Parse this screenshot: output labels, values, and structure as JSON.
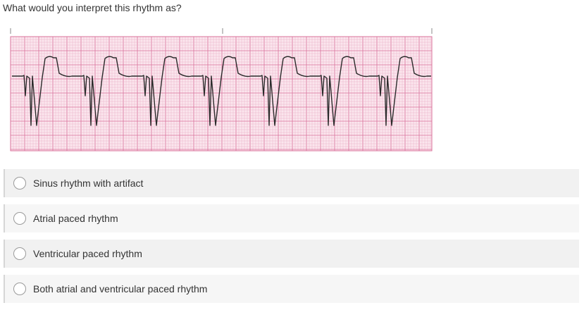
{
  "question": {
    "text": "What would you interpret this rhythm as?"
  },
  "strip": {
    "grid_color": "#e9a9c0",
    "grid_major_color": "#d9709a",
    "paper_color": "#fbe6ee",
    "trace_color": "#2b2b2b"
  },
  "options": [
    {
      "label": "Sinus rhythm with artifact",
      "selected": false
    },
    {
      "label": "Atrial paced rhythm",
      "selected": false
    },
    {
      "label": "Ventricular paced rhythm",
      "selected": false
    },
    {
      "label": "Both atrial and ventricular paced rhythm",
      "selected": false
    }
  ]
}
